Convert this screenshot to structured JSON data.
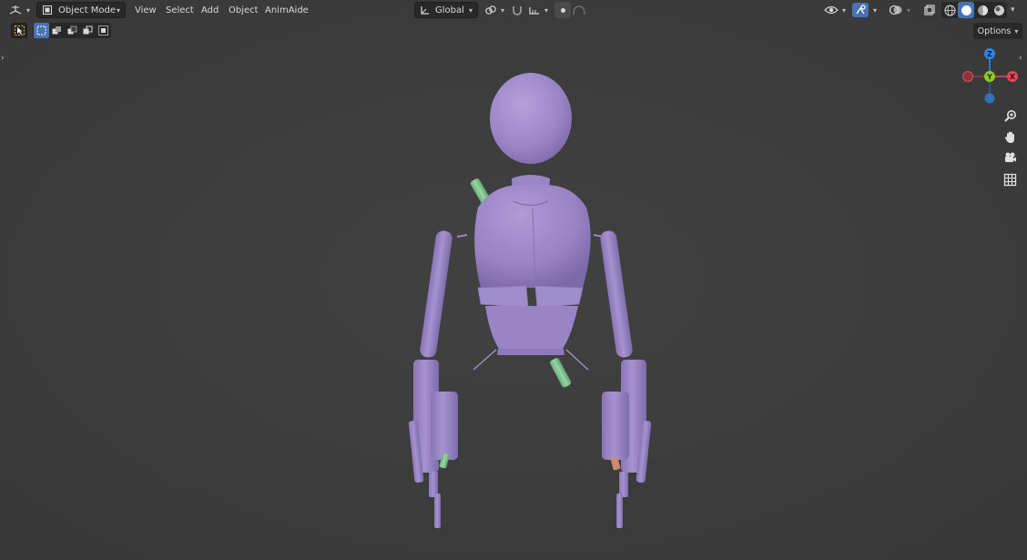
{
  "header": {
    "editor_type_icon": "camera-grid-icon",
    "mode_label": "Object Mode",
    "menus": [
      "View",
      "Select",
      "Add",
      "Object",
      "AnimAide"
    ],
    "transform_orientation": "Global"
  },
  "toolbar": {
    "select_tool_icon": "cursor-select-icon",
    "select_mode_icons": [
      "select-new-icon",
      "select-extend-icon",
      "select-subtract-icon",
      "select-invert-icon",
      "select-intersect-icon"
    ]
  },
  "options_label": "Options",
  "gizmo": {
    "z_label": "Z",
    "y_label": "Y",
    "x_label": "X"
  },
  "colors": {
    "viewport_bg": "#3d3d3d",
    "model": "#9b87c6",
    "bone_green": "#7fc48f",
    "accent_blue": "#4772b3",
    "axis_x": "#e24a5c",
    "axis_y": "#8ccd20",
    "axis_z": "#2f84e3"
  }
}
